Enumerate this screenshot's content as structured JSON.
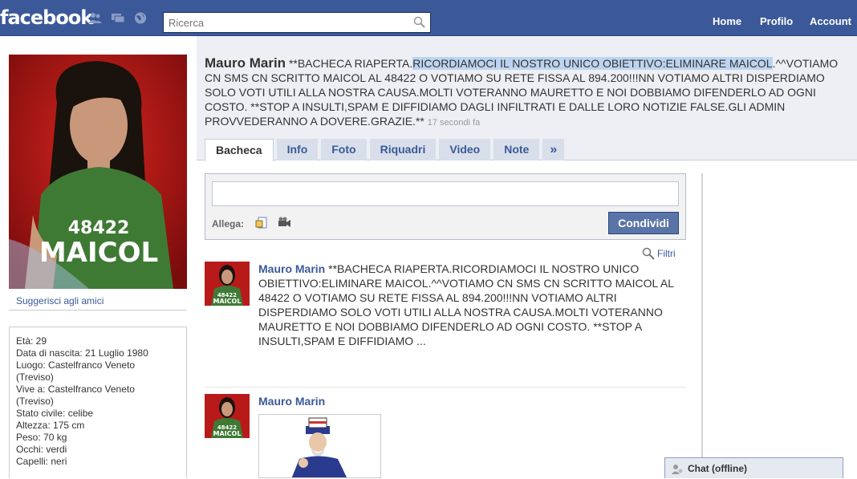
{
  "topbar": {
    "logo": "facebook",
    "search_placeholder": "Ricerca",
    "nav": {
      "home": "Home",
      "profile": "Profilo",
      "account": "Account"
    }
  },
  "profile": {
    "name": "Mauro Marin",
    "status_before": " **BACHECA RIAPERTA.",
    "status_highlight": "RICORDIAMOCI IL NOSTRO UNICO OBIETTIVO:ELIMINARE MAICOL",
    "status_after": ".^^VOTIAMO CN SMS CN SCRITTO MAICOL AL 48422 O VOTIAMO SU RETE FISSA AL 894.200!!!NN VOTIAMO ALTRI DISPERDIAMO SOLO VOTI UTILI ALLA NOSTRA CAUSA.MOLTI VOTERANNO MAURETTO E NOI DOBBIAMO DIFENDERLO AD OGNI COSTO. **STOP A INSULTI,SPAM E DIFFIDIAMO DAGLI INFILTRATI E DALLE LORO NOTIZIE FALSE.GLI ADMIN PROVVEDERANNO A DOVERE.GRAZIE.**",
    "status_time": "17 secondi fa",
    "suggest_link": "Suggerisci agli amici",
    "shirt_number": "48422",
    "shirt_name": "MAICOL"
  },
  "info": {
    "lines": [
      "Età: 29",
      "Data di nascita: 21 Luglio 1980",
      "Luogo: Castelfranco Veneto",
      "(Treviso)",
      "Vive a: Castelfranco Veneto",
      "(Treviso)",
      "Stato civile: celibe",
      "Altezza: 175 cm",
      "Peso: 70 kg",
      "Occhi: verdi",
      "Capelli: neri"
    ]
  },
  "tabs": [
    "Bacheca",
    "Info",
    "Foto",
    "Riquadri",
    "Video",
    "Note",
    "»"
  ],
  "composer": {
    "attach_label": "Allega:",
    "share_label": "Condividi"
  },
  "filters_label": "Filtri",
  "posts": [
    {
      "author": "Mauro Marin",
      "text": " **BACHECA RIAPERTA.RICORDIAMOCI IL NOSTRO UNICO OBIETTIVO:ELIMINARE MAICOL.^^VOTIAMO CN SMS CN SCRITTO MAICOL AL 48422 O VOTIAMO SU RETE FISSA AL 894.200!!!NN VOTIAMO ALTRI DISPERDIAMO SOLO VOTI UTILI ALLA NOSTRA CAUSA.MOLTI VOTERANNO MAURETTO E NOI DOBBIAMO DIFENDERLO AD OGNI COSTO. **STOP A INSULTI,SPAM E DIFFIDIAMO ..."
    },
    {
      "author": "Mauro Marin",
      "text": ""
    }
  ],
  "chat": {
    "label": "Chat (offline)"
  },
  "colors": {
    "brand": "#3b5998",
    "header_bg": "#edeff4",
    "highlight": "#bcd4f0"
  }
}
